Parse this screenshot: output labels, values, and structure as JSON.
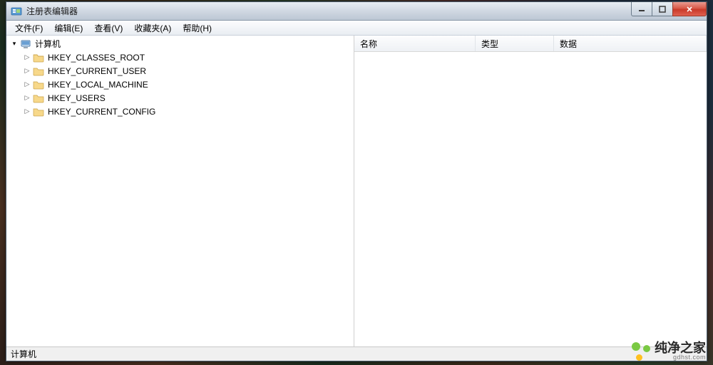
{
  "window": {
    "title": "注册表编辑器"
  },
  "menu": {
    "file": "文件(F)",
    "edit": "编辑(E)",
    "view": "查看(V)",
    "favorites": "收藏夹(A)",
    "help": "帮助(H)"
  },
  "tree": {
    "root_label": "计算机",
    "hives": [
      "HKEY_CLASSES_ROOT",
      "HKEY_CURRENT_USER",
      "HKEY_LOCAL_MACHINE",
      "HKEY_USERS",
      "HKEY_CURRENT_CONFIG"
    ]
  },
  "list": {
    "columns": {
      "name": "名称",
      "type": "类型",
      "data": "数据"
    }
  },
  "statusbar": {
    "path": "计算机"
  },
  "watermark": {
    "brand": "纯净之家",
    "domain": "gdhst.com"
  },
  "icons": {
    "app": "regedit-icon",
    "computer": "computer-icon",
    "folder": "folder-icon",
    "expander_open": "▾",
    "expander_closed": "▷"
  },
  "colors": {
    "titlebar_top": "#e8edf3",
    "titlebar_bottom": "#bcc7d4",
    "close_red": "#d85a4a",
    "folder": "#f7c96b",
    "accent_green": "#7ac943",
    "accent_yellow": "#ffc020"
  }
}
